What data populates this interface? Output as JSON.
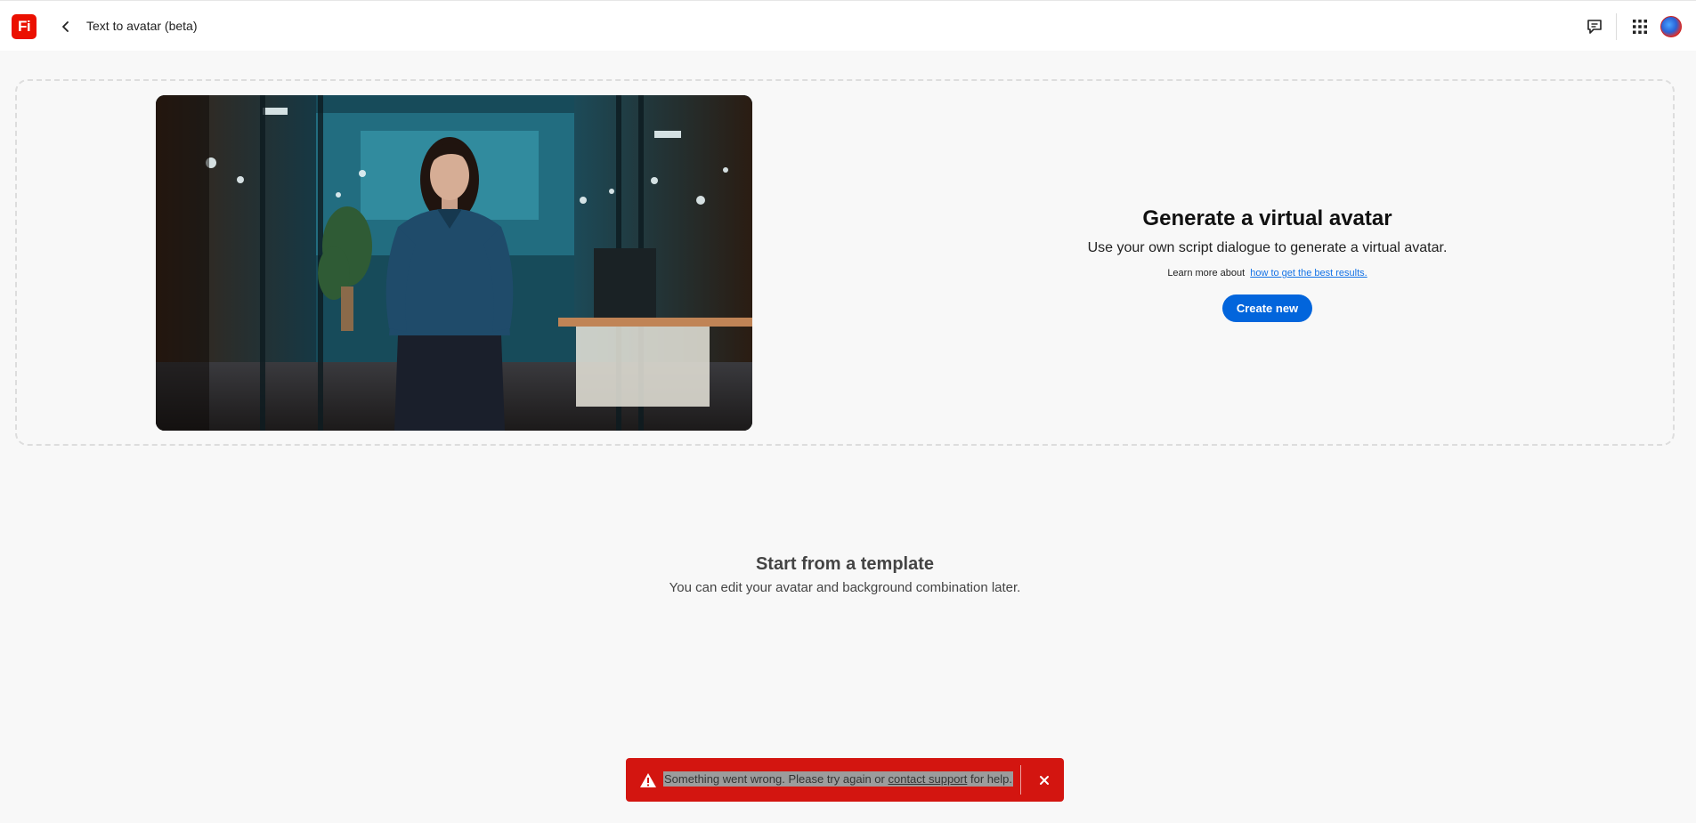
{
  "header": {
    "logo_text": "Fi",
    "title": "Text to avatar (beta)",
    "icons": [
      "chevron-left-icon",
      "feedback-icon",
      "apps-grid-icon",
      "user-avatar"
    ]
  },
  "hero": {
    "title": "Generate a virtual avatar",
    "subtitle": "Use your own script dialogue to generate a virtual avatar.",
    "learn_prefix": "Learn more about",
    "learn_link": "how to get the best results.",
    "create_label": "Create new"
  },
  "templates": {
    "title": "Start from a template",
    "subtitle": "You can edit your avatar and background combination later."
  },
  "toast": {
    "msg_prefix": "Something went wrong. Please try again or",
    "msg_link": "contact support",
    "msg_suffix": "for help.",
    "color": "#d31510"
  },
  "colors": {
    "accent": "#0265dc",
    "brand": "#eb1000",
    "link": "#1473e6"
  }
}
